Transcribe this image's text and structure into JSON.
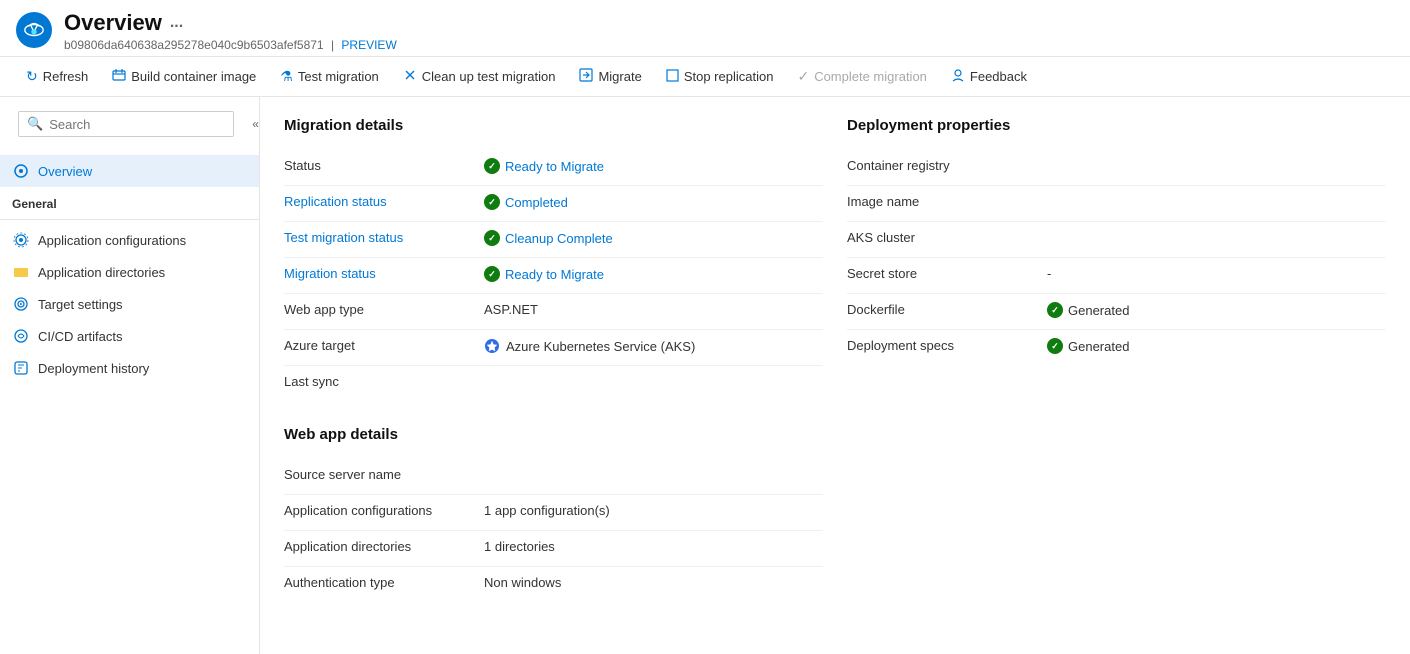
{
  "header": {
    "title": "Overview",
    "ellipsis": "...",
    "subtitle_id": "b09806da640638a295278e040c9b6503afef5871",
    "subtitle_sep": "|",
    "subtitle_preview": "PREVIEW"
  },
  "toolbar": {
    "buttons": [
      {
        "id": "refresh",
        "label": "Refresh",
        "icon": "↻",
        "disabled": false
      },
      {
        "id": "build-container-image",
        "label": "Build container image",
        "icon": "🏗",
        "disabled": false
      },
      {
        "id": "test-migration",
        "label": "Test migration",
        "icon": "⚗",
        "disabled": false
      },
      {
        "id": "clean-test-migration",
        "label": "Clean up test migration",
        "icon": "✂",
        "disabled": false
      },
      {
        "id": "migrate",
        "label": "Migrate",
        "icon": "⬆",
        "disabled": false
      },
      {
        "id": "stop-replication",
        "label": "Stop replication",
        "icon": "⬜",
        "disabled": false
      },
      {
        "id": "complete-migration",
        "label": "Complete migration",
        "icon": "✓",
        "disabled": true
      },
      {
        "id": "feedback",
        "label": "Feedback",
        "icon": "👤",
        "disabled": false
      }
    ]
  },
  "sidebar": {
    "search_placeholder": "Search",
    "overview_label": "Overview",
    "general_label": "General",
    "items": [
      {
        "id": "app-configurations",
        "label": "Application configurations"
      },
      {
        "id": "app-directories",
        "label": "Application directories"
      },
      {
        "id": "target-settings",
        "label": "Target settings"
      },
      {
        "id": "cicd-artifacts",
        "label": "CI/CD artifacts"
      },
      {
        "id": "deployment-history",
        "label": "Deployment history"
      }
    ]
  },
  "migration_details": {
    "section_title": "Migration details",
    "rows": [
      {
        "label": "Status",
        "label_link": false,
        "value": "Ready to Migrate",
        "value_type": "status-green"
      },
      {
        "label": "Replication status",
        "label_link": true,
        "value": "Completed",
        "value_type": "status-green"
      },
      {
        "label": "Test migration status",
        "label_link": true,
        "value": "Cleanup Complete",
        "value_type": "status-green"
      },
      {
        "label": "Migration status",
        "label_link": true,
        "value": "Ready to Migrate",
        "value_type": "status-green"
      },
      {
        "label": "Web app type",
        "label_link": false,
        "value": "ASP.NET",
        "value_type": "text"
      },
      {
        "label": "Azure target",
        "label_link": false,
        "value": "Azure Kubernetes Service (AKS)",
        "value_type": "k8s"
      },
      {
        "label": "Last sync",
        "label_link": false,
        "value": "",
        "value_type": "text"
      }
    ]
  },
  "web_app_details": {
    "section_title": "Web app details",
    "rows": [
      {
        "label": "Source server name",
        "label_link": false,
        "value": "",
        "value_type": "text"
      },
      {
        "label": "Application configurations",
        "label_link": false,
        "value": "1 app configuration(s)",
        "value_type": "text"
      },
      {
        "label": "Application directories",
        "label_link": false,
        "value": "1 directories",
        "value_type": "text"
      },
      {
        "label": "Authentication type",
        "label_link": false,
        "value": "Non windows",
        "value_type": "text"
      }
    ]
  },
  "deployment_properties": {
    "section_title": "Deployment properties",
    "rows": [
      {
        "label": "Container registry",
        "label_link": false,
        "value": "",
        "value_type": "text"
      },
      {
        "label": "Image name",
        "label_link": false,
        "value": "",
        "value_type": "text"
      },
      {
        "label": "AKS cluster",
        "label_link": false,
        "value": "",
        "value_type": "text"
      },
      {
        "label": "Secret store",
        "label_link": false,
        "value": "-",
        "value_type": "text"
      },
      {
        "label": "Dockerfile",
        "label_link": false,
        "value": "Generated",
        "value_type": "status-green-simple"
      },
      {
        "label": "Deployment specs",
        "label_link": false,
        "value": "Generated",
        "value_type": "status-green-simple"
      }
    ]
  }
}
